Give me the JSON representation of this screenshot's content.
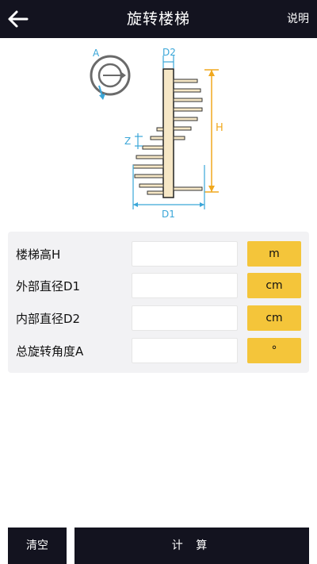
{
  "header": {
    "title": "旋转楼梯",
    "help_label": "说明"
  },
  "diagram": {
    "label_a": "A",
    "label_d2": "D2",
    "label_h": "H",
    "label_z": "Z",
    "label_d1": "D1"
  },
  "fields": [
    {
      "label": "楼梯高H",
      "value": "",
      "unit": "m"
    },
    {
      "label": "外部直径D1",
      "value": "",
      "unit": "cm"
    },
    {
      "label": "内部直径D2",
      "value": "",
      "unit": "cm"
    },
    {
      "label": "总旋转角度A",
      "value": "",
      "unit": "°"
    }
  ],
  "actions": {
    "clear_label": "清空",
    "calc_label": "计 算"
  },
  "colors": {
    "bar": "#13131f",
    "accent": "#f4c53a",
    "dim_blue": "#3aa6d8",
    "dim_orange": "#f0a81e",
    "wood": "#f6e7c6"
  }
}
